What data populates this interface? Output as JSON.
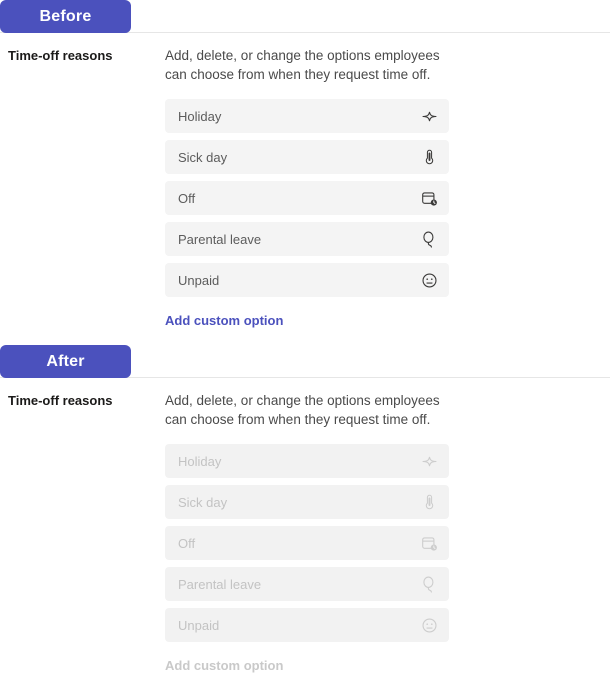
{
  "sections": [
    {
      "badge_label": "Before",
      "state": "enabled",
      "setting_label": "Time-off reasons",
      "description": "Add, delete, or change the options employees can choose from when they request time off.",
      "options": [
        {
          "label": "Holiday",
          "icon": "sparkle-icon"
        },
        {
          "label": "Sick day",
          "icon": "thermometer-icon"
        },
        {
          "label": "Off",
          "icon": "calendar-clock-icon"
        },
        {
          "label": "Parental leave",
          "icon": "balloon-icon"
        },
        {
          "label": "Unpaid",
          "icon": "neutral-face-icon"
        }
      ],
      "add_link_label": "Add custom option"
    },
    {
      "badge_label": "After",
      "state": "disabled",
      "setting_label": "Time-off reasons",
      "description": "Add, delete, or change the options employees can choose from when they request time off.",
      "options": [
        {
          "label": "Holiday",
          "icon": "sparkle-icon"
        },
        {
          "label": "Sick day",
          "icon": "thermometer-icon"
        },
        {
          "label": "Off",
          "icon": "calendar-clock-icon"
        },
        {
          "label": "Parental leave",
          "icon": "balloon-icon"
        },
        {
          "label": "Unpaid",
          "icon": "neutral-face-icon"
        }
      ],
      "add_link_label": "Add custom option"
    }
  ],
  "colors": {
    "badge_background": "#4b51bd",
    "badge_text": "#ffffff",
    "link": "#4b51bd",
    "row_background": "#f4f4f4",
    "label_text": "#1b1a19",
    "description_text": "#4a4a4a",
    "option_text": "#5c5c5c",
    "disabled_text": "#c3c3c3",
    "divider": "#e6e6e6"
  }
}
